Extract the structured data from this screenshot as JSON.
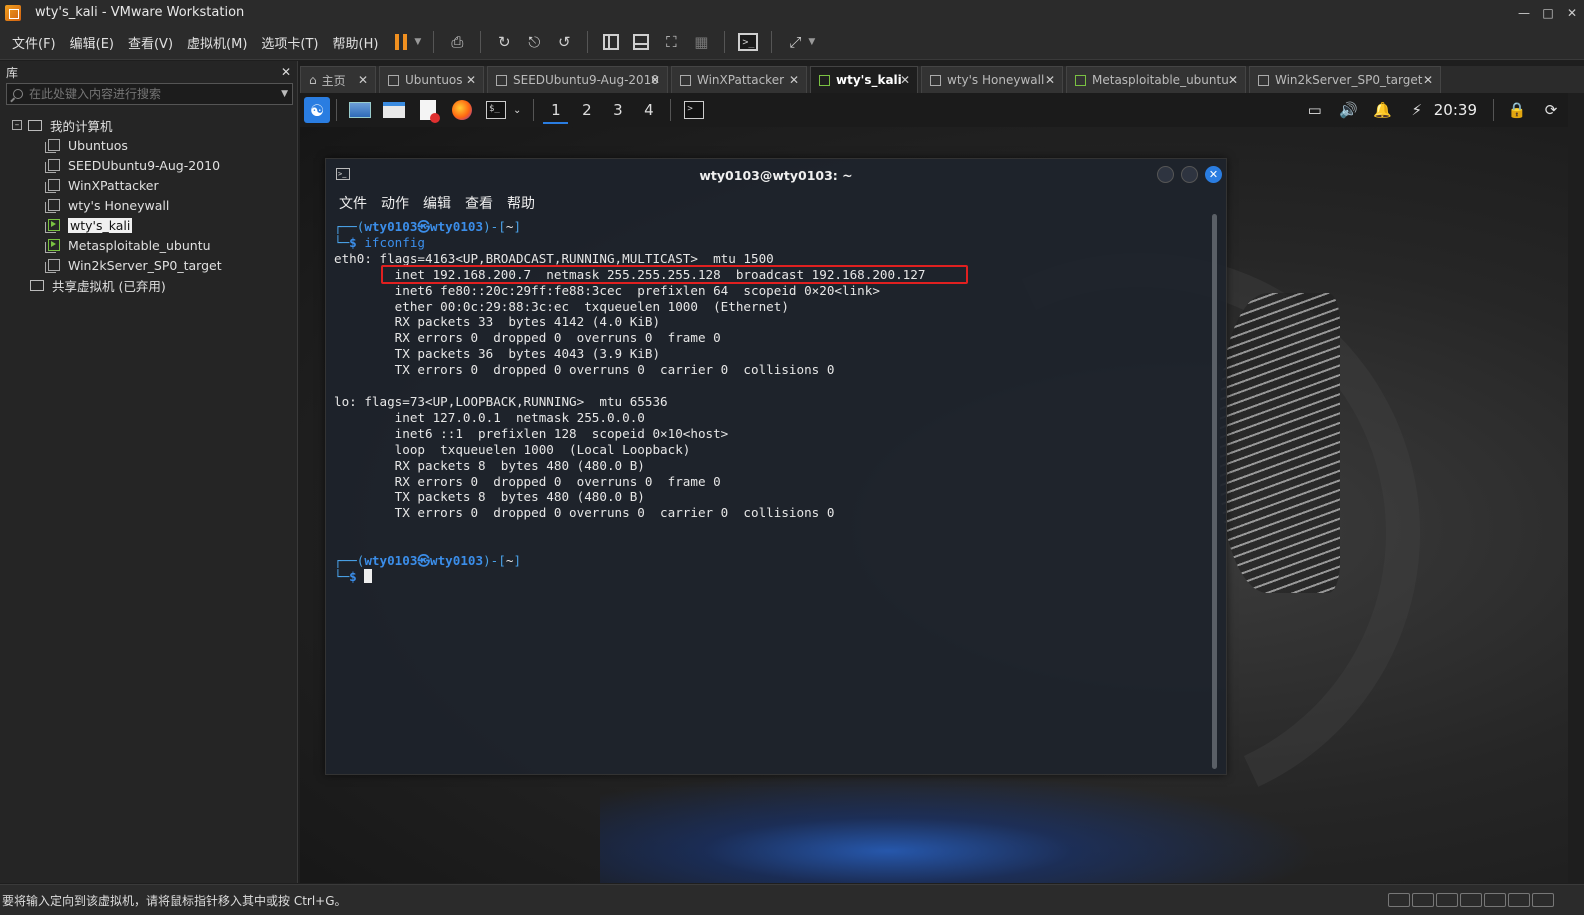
{
  "window": {
    "title": "wty's_kali - VMware Workstation"
  },
  "menu": [
    "文件(F)",
    "编辑(E)",
    "查看(V)",
    "虚拟机(M)",
    "选项卡(T)",
    "帮助(H)"
  ],
  "sidebar": {
    "header": "库",
    "search_placeholder": "在此处键入内容进行搜索",
    "root": "我的计算机",
    "items": [
      {
        "label": "Ubuntuos",
        "running": false
      },
      {
        "label": "SEEDUbuntu9-Aug-2010",
        "running": false
      },
      {
        "label": "WinXPattacker",
        "running": false
      },
      {
        "label": "wty's Honeywall",
        "running": false
      },
      {
        "label": "wty's_kali",
        "running": true,
        "selected": true
      },
      {
        "label": "Metasploitable_ubuntu",
        "running": true
      },
      {
        "label": "Win2kServer_SP0_target",
        "running": false
      }
    ],
    "shared": "共享虚拟机 (已弃用)"
  },
  "tabs": [
    {
      "label": "主页"
    },
    {
      "label": "Ubuntuos"
    },
    {
      "label": "SEEDUbuntu9-Aug-2010"
    },
    {
      "label": "WinXPattacker"
    },
    {
      "label": "wty's_kali",
      "active": true
    },
    {
      "label": "wty's Honeywall"
    },
    {
      "label": "Metasploitable_ubuntu"
    },
    {
      "label": "Win2kServer_SP0_target"
    }
  ],
  "kali_panel": {
    "workspaces": [
      "1",
      "2",
      "3",
      "4"
    ],
    "active_workspace": "1",
    "clock": "20:39"
  },
  "terminal": {
    "title": "wty0103@wty0103: ~",
    "menu": [
      "文件",
      "动作",
      "编辑",
      "查看",
      "帮助"
    ],
    "prompt_user": "wty0103",
    "prompt_host": "wty0103",
    "prompt_dir": "~",
    "command": "ifconfig",
    "output": [
      "eth0: flags=4163<UP,BROADCAST,RUNNING,MULTICAST>  mtu 1500",
      "        inet 192.168.200.7  netmask 255.255.255.128  broadcast 192.168.200.127",
      "        inet6 fe80::20c:29ff:fe88:3cec  prefixlen 64  scopeid 0×20<link>",
      "        ether 00:0c:29:88:3c:ec  txqueuelen 1000  (Ethernet)",
      "        RX packets 33  bytes 4142 (4.0 KiB)",
      "        RX errors 0  dropped 0  overruns 0  frame 0",
      "        TX packets 36  bytes 4043 (3.9 KiB)",
      "        TX errors 0  dropped 0 overruns 0  carrier 0  collisions 0",
      "",
      "lo: flags=73<UP,LOOPBACK,RUNNING>  mtu 65536",
      "        inet 127.0.0.1  netmask 255.0.0.0",
      "        inet6 ::1  prefixlen 128  scopeid 0×10<host>",
      "        loop  txqueuelen 1000  (Local Loopback)",
      "        RX packets 8  bytes 480 (480.0 B)",
      "        RX errors 0  dropped 0  overruns 0  frame 0",
      "        TX packets 8  bytes 480 (480.0 B)",
      "        TX errors 0  dropped 0 overruns 0  carrier 0  collisions 0",
      "",
      ""
    ]
  },
  "statusbar": {
    "message": "要将输入定向到该虚拟机，请将鼠标指针移入其中或按 Ctrl+G。"
  }
}
